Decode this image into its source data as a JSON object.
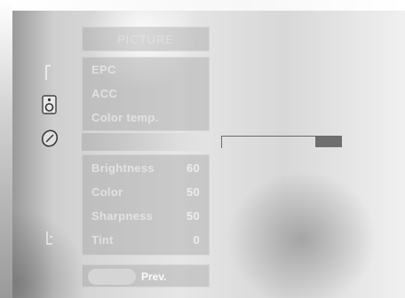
{
  "title": "PICTURE",
  "menu": {
    "items": [
      {
        "label": "EPC"
      },
      {
        "label": "ACC"
      },
      {
        "label": "Color temp."
      }
    ]
  },
  "adjust": {
    "rows": [
      {
        "label": "Brightness",
        "value": "60"
      },
      {
        "label": "Color",
        "value": "50"
      },
      {
        "label": "Sharpness",
        "value": "50"
      },
      {
        "label": "Tint",
        "value": "0"
      }
    ]
  },
  "footer": {
    "prev_label": "Prev."
  },
  "slider": {
    "level": 0.78
  },
  "icons": [
    {
      "name": "picture-icon"
    },
    {
      "name": "sound-icon"
    },
    {
      "name": "time-icon"
    },
    {
      "name": "setup-icon"
    }
  ]
}
